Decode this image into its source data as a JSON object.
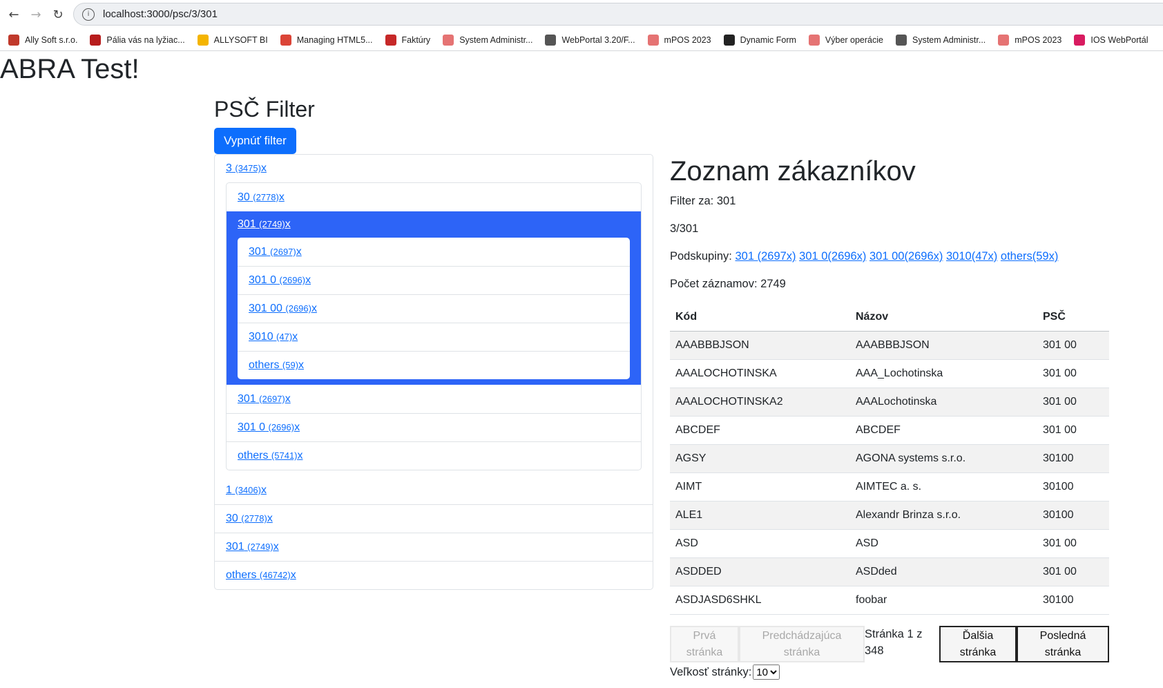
{
  "browser": {
    "url": "localhost:3000/psc/3/301",
    "bookmarks": [
      {
        "label": "Ally Soft s.r.o.",
        "icon": "ally-soft-icon",
        "color": "#c0392b"
      },
      {
        "label": "Pália vás na lyžiac...",
        "icon": "news-icon",
        "color": "#b71c1c"
      },
      {
        "label": "ALLYSOFT BI",
        "icon": "allysoft-bi-icon",
        "color": "#f4b400"
      },
      {
        "label": "Managing HTML5...",
        "icon": "chrome-icon",
        "color": "#db4437"
      },
      {
        "label": "Faktúry",
        "icon": "invoice-icon",
        "color": "#c62828"
      },
      {
        "label": "System Administr...",
        "icon": "abra-icon",
        "color": "#e57373"
      },
      {
        "label": "WebPortal 3.20/F...",
        "icon": "webportal-icon",
        "color": "#555555"
      },
      {
        "label": "mPOS 2023",
        "icon": "abra-icon",
        "color": "#e57373"
      },
      {
        "label": "Dynamic Form",
        "icon": "github-icon",
        "color": "#222222"
      },
      {
        "label": "Výber operácie",
        "icon": "abra-icon",
        "color": "#e57373"
      },
      {
        "label": "System Administr...",
        "icon": "webportal-icon",
        "color": "#555555"
      },
      {
        "label": "mPOS 2023",
        "icon": "abra-icon",
        "color": "#e57373"
      },
      {
        "label": "IOS WebPortál",
        "icon": "ios-icon",
        "color": "#d81b60"
      }
    ]
  },
  "app_title": "ABRA Test!",
  "filter": {
    "title": "PSČ Filter",
    "toggle_label": "Vypnúť filter",
    "tree": {
      "root": {
        "label": "3",
        "count": "(3475)",
        "x": "x"
      },
      "children": [
        {
          "label": "30",
          "count": "(2778)",
          "x": "x"
        }
      ],
      "active": {
        "label": "301",
        "count": "(2749)",
        "x": "x"
      },
      "active_children": [
        {
          "label": "301",
          "count": "(2697)",
          "x": "x"
        },
        {
          "label": "301 0",
          "count": "(2696)",
          "x": "x"
        },
        {
          "label": "301 00",
          "count": "(2696)",
          "x": "x"
        },
        {
          "label": "3010",
          "count": "(47)",
          "x": "x"
        },
        {
          "label": "others",
          "count": "(59)",
          "x": "x"
        }
      ],
      "after_active": [
        {
          "label": "301",
          "count": "(2697)",
          "x": "x"
        },
        {
          "label": "301 0",
          "count": "(2696)",
          "x": "x"
        },
        {
          "label": "others",
          "count": "(5741)",
          "x": "x"
        }
      ],
      "top_level": [
        {
          "label": "1",
          "count": "(3406)",
          "x": "x"
        },
        {
          "label": "30",
          "count": "(2778)",
          "x": "x"
        },
        {
          "label": "301",
          "count": "(2749)",
          "x": "x"
        },
        {
          "label": "others",
          "count": "(46742)",
          "x": "x"
        }
      ]
    }
  },
  "list": {
    "title": "Zoznam zákazníkov",
    "filter_line": "Filter za: 301",
    "path": "3/301",
    "subgroups_label": "Podskupiny:",
    "subgroups": [
      "301 (2697x)",
      "301 0(2696x)",
      "301 00(2696x)",
      "3010(47x)",
      "others(59x)"
    ],
    "count_line": "Počet záznamov: 2749",
    "columns": [
      "Kód",
      "Názov",
      "PSČ"
    ],
    "rows": [
      [
        "AAABBBJSON",
        "AAABBBJSON",
        "301 00"
      ],
      [
        "AAALOCHOTINSKA",
        "AAA_Lochotinska",
        "301 00"
      ],
      [
        "AAALOCHOTINSKA2",
        "AAALochotinska",
        "301 00"
      ],
      [
        "ABCDEF",
        "ABCDEF",
        "301 00"
      ],
      [
        "AGSY",
        "AGONA systems s.r.o.",
        "30100"
      ],
      [
        "AIMT",
        "AIMTEC a. s.",
        "30100"
      ],
      [
        "ALE1",
        "Alexandr Brinza s.r.o.",
        "30100"
      ],
      [
        "ASD",
        "ASD",
        "301 00"
      ],
      [
        "ASDDED",
        "ASDded",
        "301 00"
      ],
      [
        "ASDJASD6SHKL",
        "foobar",
        "30100"
      ]
    ],
    "pager": {
      "first": "Prvá stránka",
      "prev": "Predchádzajúca stránka",
      "info": "Stránka 1 z 348",
      "next": "Ďalšia stránka",
      "last": "Posledná stránka",
      "size_label": "Veľkosť stránky:",
      "size_value": "10"
    }
  }
}
